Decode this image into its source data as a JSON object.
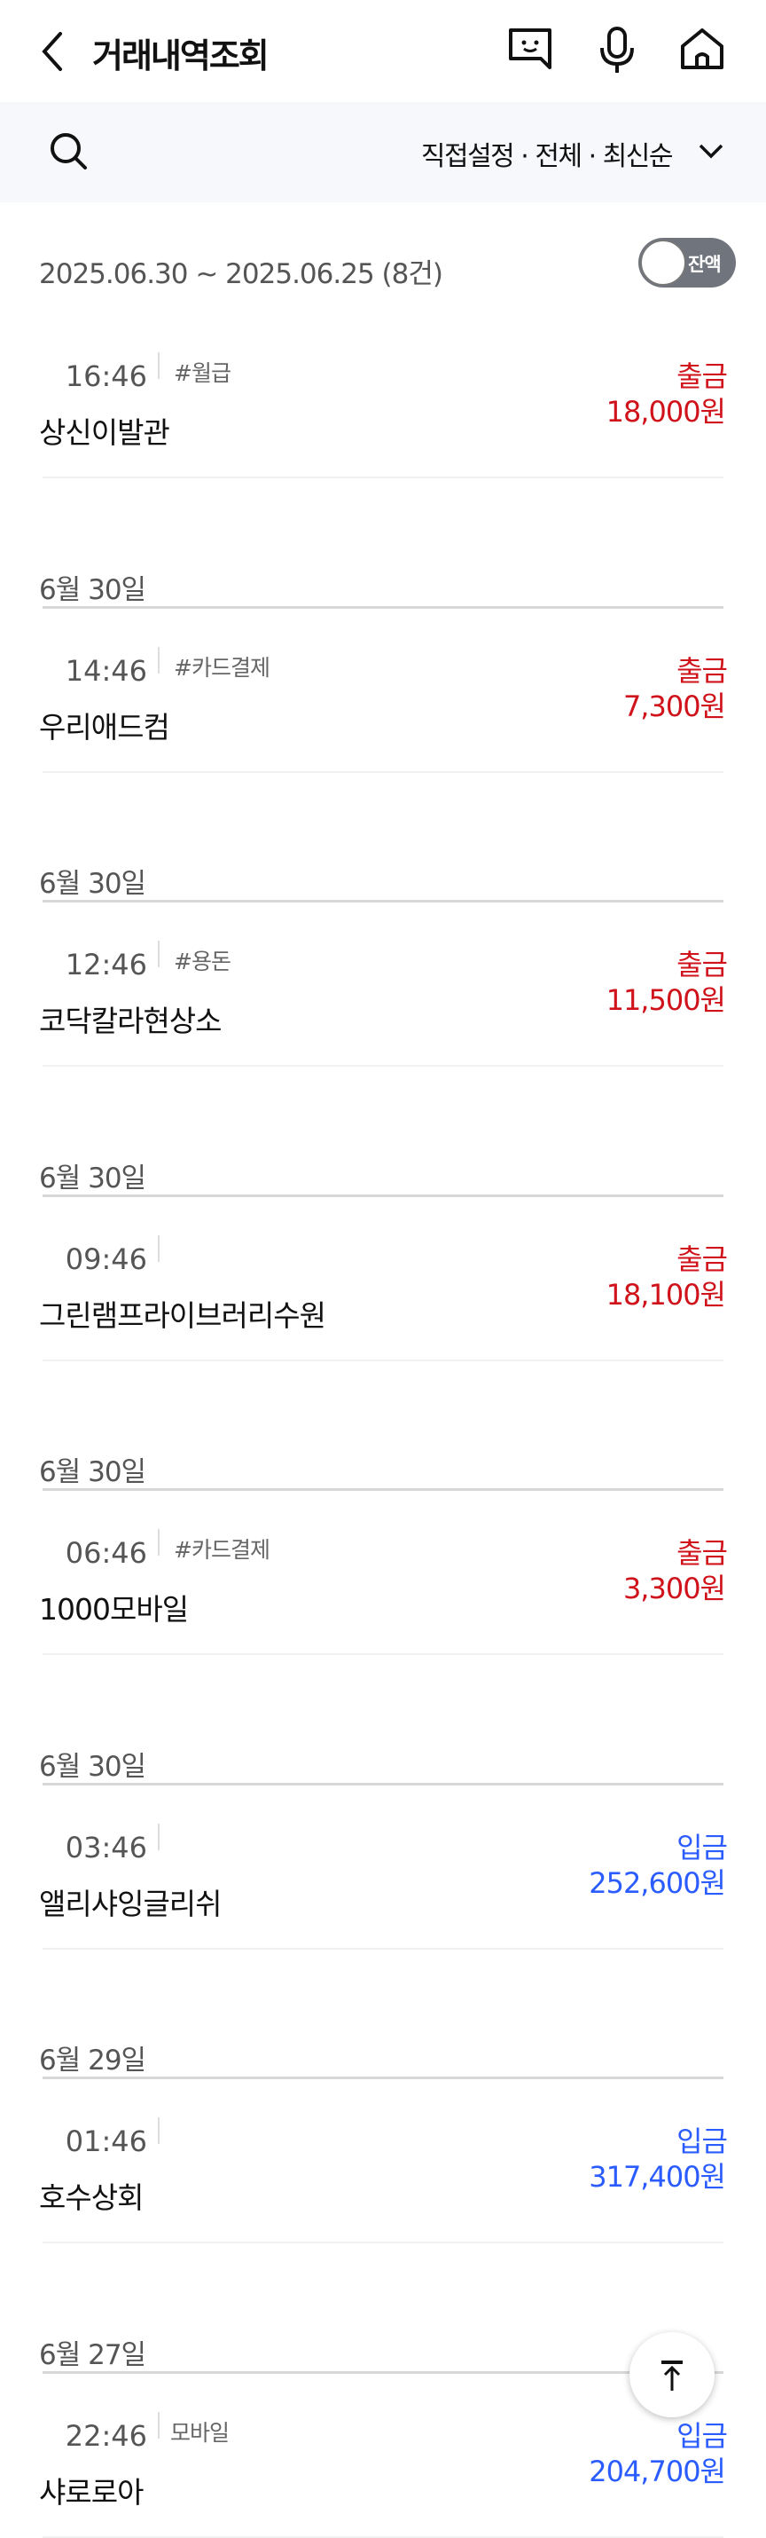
{
  "header": {
    "title": "거래내역조회",
    "icons": [
      "back-icon",
      "chatbot-icon",
      "microphone-icon",
      "home-icon"
    ]
  },
  "filter": {
    "label": "직접설정 · 전체 · 최신순"
  },
  "summary": {
    "range": "2025.06.30 ~ 2025.06.25 (8건)",
    "balance_toggle": "잔액"
  },
  "colors": {
    "withdraw": "#d0121b",
    "deposit": "#2b5cff"
  },
  "transactions": [
    {
      "date": "",
      "time": "16:46",
      "tag": "#월급",
      "name": "상신이발관",
      "type": "출금",
      "amount": "18,000원",
      "kind": "out"
    },
    {
      "date": "6월 30일",
      "time": "14:46",
      "tag": "#카드결제",
      "name": "우리애드컴",
      "type": "출금",
      "amount": "7,300원",
      "kind": "out"
    },
    {
      "date": "6월 30일",
      "time": "12:46",
      "tag": "#용돈",
      "name": "코닥칼라현상소",
      "type": "출금",
      "amount": "11,500원",
      "kind": "out"
    },
    {
      "date": "6월 30일",
      "time": "09:46",
      "tag": "",
      "name": "그린램프라이브러리수원",
      "type": "출금",
      "amount": "18,100원",
      "kind": "out"
    },
    {
      "date": "6월 30일",
      "time": "06:46",
      "tag": "#카드결제",
      "name": "1000모바일",
      "type": "출금",
      "amount": "3,300원",
      "kind": "out"
    },
    {
      "date": "6월 30일",
      "time": "03:46",
      "tag": "",
      "name": "앨리샤잉글리쉬",
      "type": "입금",
      "amount": "252,600원",
      "kind": "in"
    },
    {
      "date": "6월 29일",
      "time": "01:46",
      "tag": "",
      "name": "호수상회",
      "type": "입금",
      "amount": "317,400원",
      "kind": "in"
    },
    {
      "date": "6월 27일",
      "time": "22:46",
      "tag": "모바일",
      "name": "샤로로아",
      "type": "입금",
      "amount": "204,700원",
      "kind": "in"
    }
  ]
}
